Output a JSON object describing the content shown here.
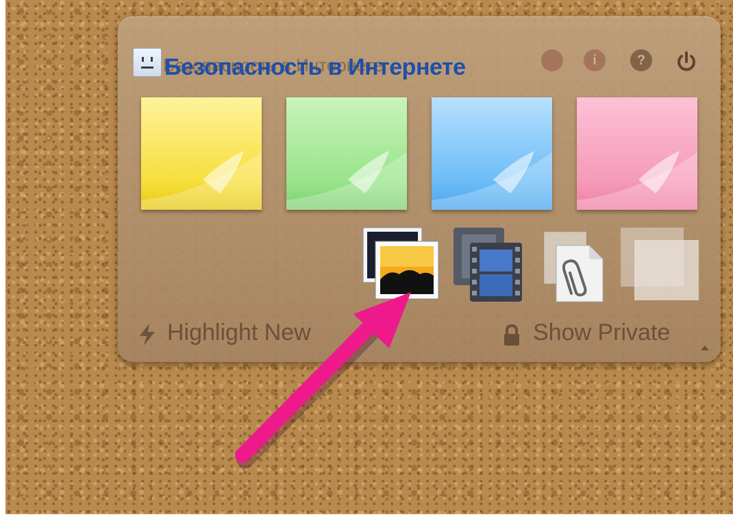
{
  "panel": {
    "title_ghost": "Безопасность в Интернете",
    "title_overlay": "Безопасность в Интернете"
  },
  "top_icons": [
    {
      "name": "back-icon",
      "glyph": ""
    },
    {
      "name": "info-icon",
      "glyph": "i"
    },
    {
      "name": "help-icon",
      "glyph": "?"
    },
    {
      "name": "power-icon",
      "glyph": ""
    }
  ],
  "notes": [
    {
      "name": "note-yellow",
      "color": "#f7df3b"
    },
    {
      "name": "note-green",
      "color": "#98e48b"
    },
    {
      "name": "note-blue",
      "color": "#6cbcf7"
    },
    {
      "name": "note-pink",
      "color": "#f59ab9"
    }
  ],
  "media_icons": [
    "image-icon",
    "film-icon",
    "attachment-icon",
    "blank-note-icon"
  ],
  "footer": {
    "highlight_label": "Highlight New",
    "private_label": "Show Private"
  },
  "colors": {
    "title_overlay": "#1f4fa8",
    "arrow": "#ee1a8c"
  }
}
